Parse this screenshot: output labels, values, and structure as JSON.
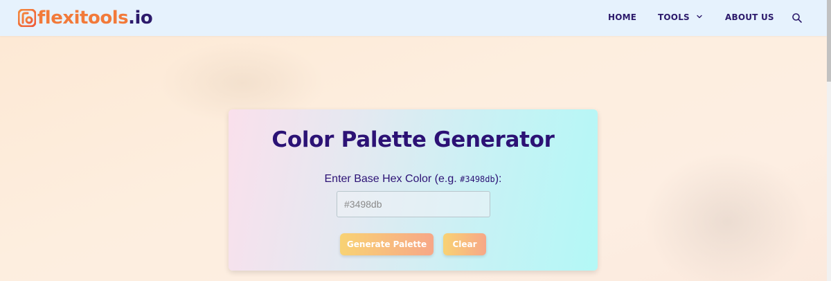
{
  "header": {
    "logo": {
      "flexi": "flexitools",
      "tld": ".io"
    },
    "nav": [
      {
        "label": "HOME"
      },
      {
        "label": "TOOLS",
        "has_dropdown": true
      },
      {
        "label": "ABOUT US"
      }
    ],
    "search_icon": "search-icon"
  },
  "main": {
    "title": "Color Palette Generator",
    "input_label_prefix": "Enter Base Hex Color (e.g. ",
    "input_label_example": "#3498db",
    "input_label_suffix": "):",
    "input_placeholder": "#3498db",
    "input_value": "",
    "buttons": {
      "generate": "Generate Palette",
      "clear": "Clear"
    }
  },
  "colors": {
    "brand_orange": "#f27a3a",
    "brand_navy": "#2c1a6b",
    "title_purple": "#2c1275",
    "header_bg": "#e6f2fd"
  }
}
